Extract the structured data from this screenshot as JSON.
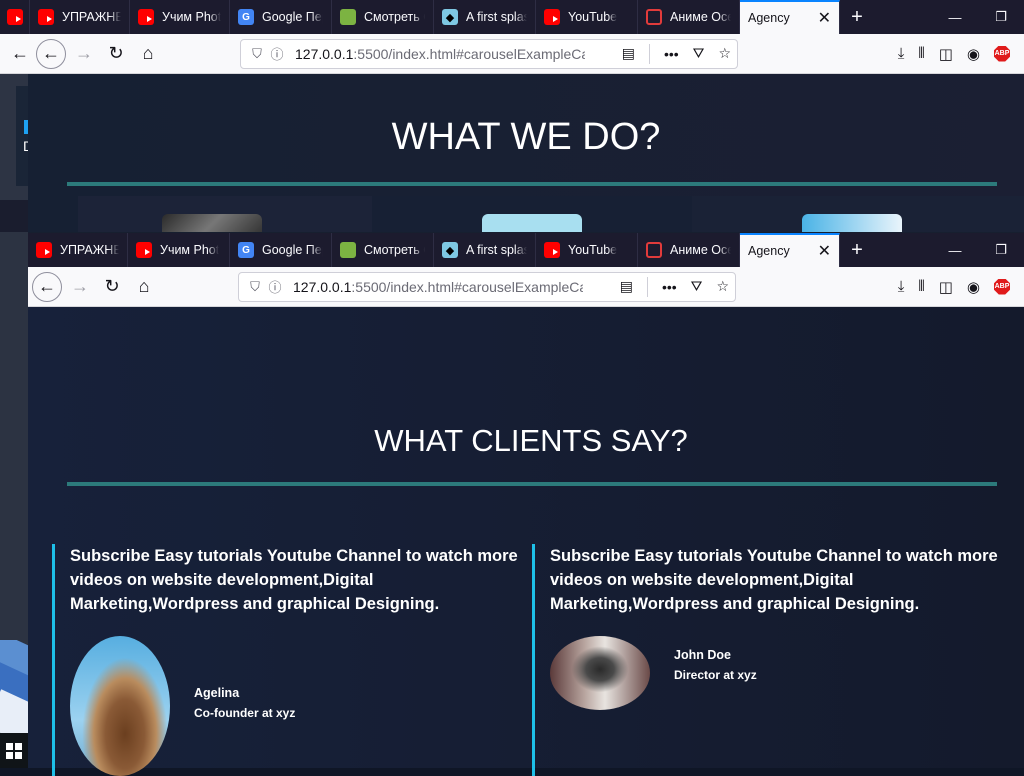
{
  "tabs": [
    {
      "label": "УПРАЖНЕ",
      "icon": "youtube-icon"
    },
    {
      "label": "Учим Phot",
      "icon": "youtube-icon"
    },
    {
      "label": "Google Пер",
      "icon": "google-translate-icon"
    },
    {
      "label": "Смотреть С",
      "icon": "smotret-icon"
    },
    {
      "label": "A first splas",
      "icon": "fish-icon"
    },
    {
      "label": "YouTube",
      "icon": "youtube-icon"
    },
    {
      "label": "Аниме Осе",
      "icon": "anime-icon"
    },
    {
      "label": "Agency",
      "icon": "none"
    }
  ],
  "url": {
    "host": "127.0.0.1",
    "path": ":5500/index.html#carouselExampleCa"
  },
  "window1": {
    "heading": "WHAT WE DO?",
    "side_letter": "D"
  },
  "window2": {
    "heading": "WHAT CLIENTS SAY?",
    "testimonials": [
      {
        "quote": "Subscribe Easy tutorials Youtube Channel to watch more videos on website development,Digital Marketing,Wordpress and graphical Designing.",
        "name": "Agelina",
        "role": "Co-founder at xyz"
      },
      {
        "quote": "Subscribe Easy tutorials Youtube Channel to watch more videos on website development,Digital Marketing,Wordpress and graphical Designing.",
        "name": "John Doe",
        "role": "Director at xyz"
      }
    ]
  },
  "colors": {
    "accent_line": "#2c7a7b",
    "testimonial_border": "#1ec0e8",
    "active_tab_highlight": "#0a84ff"
  }
}
